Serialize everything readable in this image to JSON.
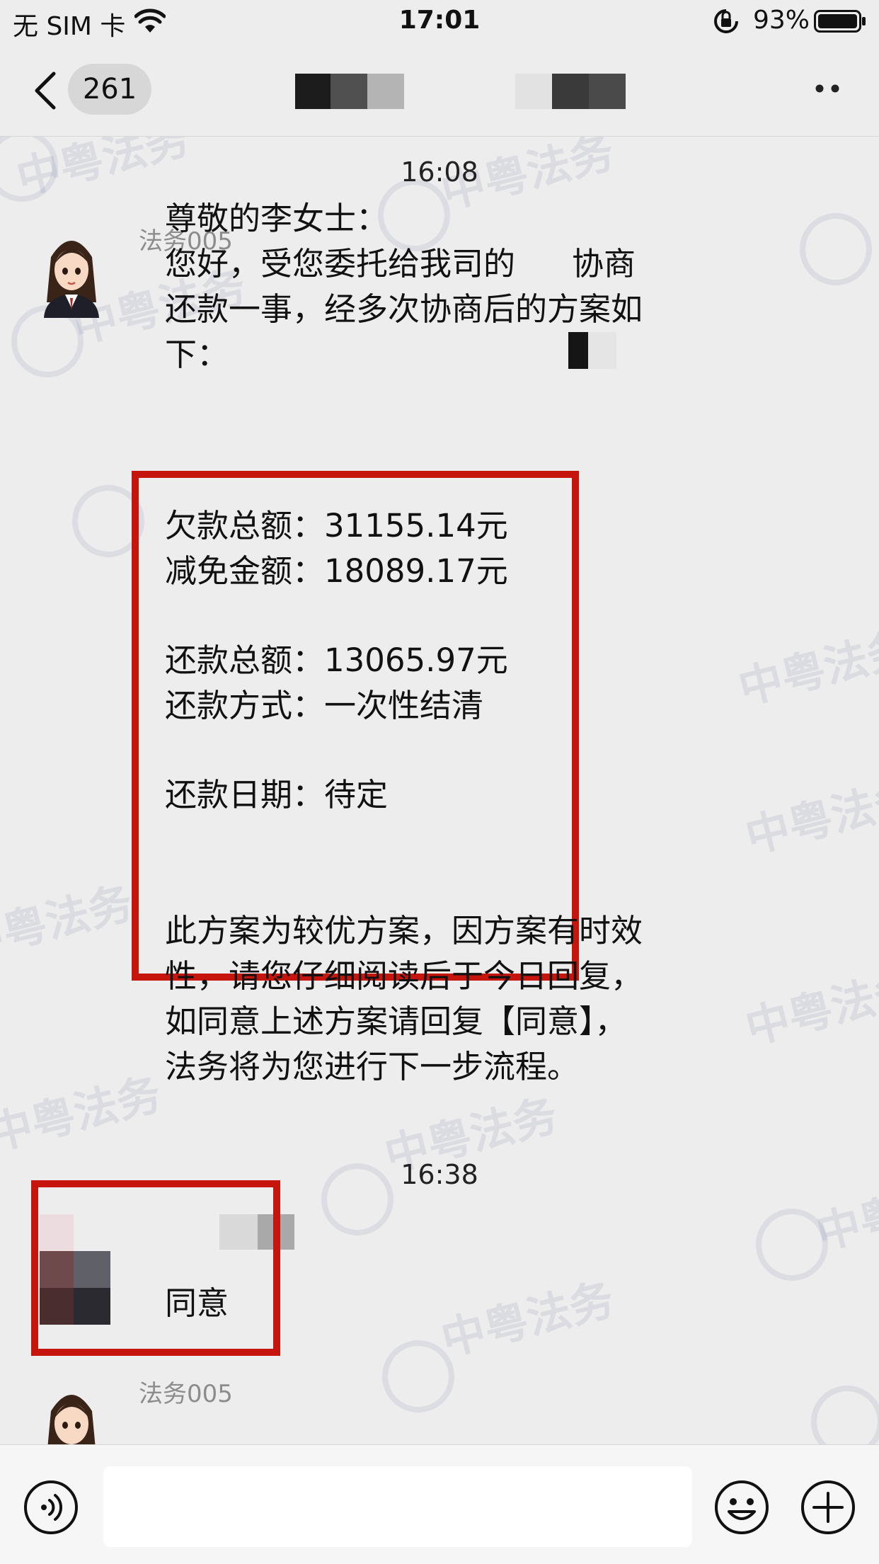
{
  "status_bar": {
    "carrier": "无 SIM 卡",
    "time": "17:01",
    "battery": "93%"
  },
  "nav": {
    "back_count": "261"
  },
  "chat": {
    "messages": [
      {
        "time": "16:08",
        "sender": "法务005",
        "intro": [
          "尊敬的李女士：",
          "您好，受您委托给我司的",
          "协商",
          "还款一事，经多次协商后的方案如",
          "下："
        ],
        "plan": [
          {
            "label": "欠款总额：",
            "value": "31155.14元"
          },
          {
            "label": "减免金额：",
            "value": "18089.17元"
          },
          {
            "label": "还款总额：",
            "value": "13065.97元"
          },
          {
            "label": "还款方式：",
            "value": "一次性结清"
          },
          {
            "label": "还款日期：",
            "value": "待定"
          }
        ],
        "closing": [
          "此方案为较优方案，因方案有时效",
          "性，请您仔细阅读后于今日回复，",
          "如同意上述方案请回复【同意】，",
          "法务将为您进行下一步流程。"
        ]
      },
      {
        "time": "16:38",
        "text": "同意"
      },
      {
        "sender": "法务005"
      }
    ],
    "watermark": "中粤法务"
  },
  "colors": {
    "highlight_border": "#c6150d",
    "background": "#ededed"
  }
}
